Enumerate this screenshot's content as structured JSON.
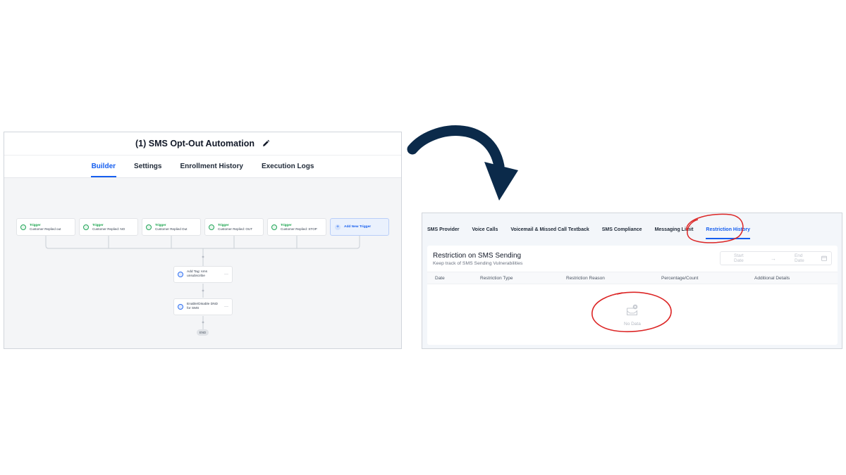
{
  "builder": {
    "title": "(1) SMS Opt-Out Automation",
    "tabs": [
      "Builder",
      "Settings",
      "Enrollment History",
      "Execution Logs"
    ],
    "active_tab": "Builder",
    "triggers": [
      {
        "kind": "Trigger",
        "label": "Customer Replied out"
      },
      {
        "kind": "Trigger",
        "label": "Customer Replied: NO"
      },
      {
        "kind": "Trigger",
        "label": "Customer Replied Out"
      },
      {
        "kind": "Trigger",
        "label": "Customer Replied: OUT"
      },
      {
        "kind": "Trigger",
        "label": "Customer Replied: STOP"
      }
    ],
    "add_trigger_label": "Add New Trigger",
    "actions": [
      {
        "label": "Add Tag: sms unsubscribe"
      },
      {
        "label": "Enable/Disable DND for SMS"
      }
    ],
    "more_label": "···",
    "end_label": "END"
  },
  "settings": {
    "tabs": [
      "SMS Provider",
      "Voice Calls",
      "Voicemail & Missed Call Textback",
      "SMS Compliance",
      "Messaging Limit",
      "Restriction History"
    ],
    "active_tab": "Restriction History",
    "card_title": "Restriction on SMS Sending",
    "card_subtitle": "Keep track of SMS Sending Vulnerabilities",
    "date_range": {
      "start_placeholder": "Start Date",
      "separator": "→",
      "end_placeholder": "End Date"
    },
    "table_columns": [
      "Date",
      "Restriction Type",
      "Restriction Reason",
      "Percentage/Count",
      "Additional Details"
    ],
    "empty_text": "No Data"
  },
  "colors": {
    "accent": "#155eef",
    "trigger_green": "#16a34a",
    "highlight_red": "#dc2626",
    "arrow_navy": "#0b2a4a"
  },
  "icons": [
    "edit-icon",
    "message-icon",
    "plus-icon",
    "tag-icon",
    "dnd-icon",
    "calendar-icon",
    "empty-inbox-icon",
    "curved-arrow-icon"
  ]
}
